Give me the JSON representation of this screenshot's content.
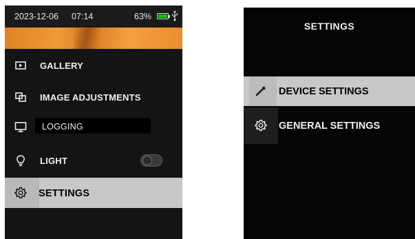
{
  "status_bar": {
    "date": "2023-12-06",
    "time": "07:14",
    "battery_percent": "63%",
    "battery_icon": "battery-icon",
    "usb_icon": "usb-icon"
  },
  "main_menu": {
    "items": [
      {
        "label": "GALLERY",
        "icon": "gallery-icon"
      },
      {
        "label": "IMAGE ADJUSTMENTS",
        "icon": "image-adjustments-icon"
      },
      {
        "label": "LOGGING",
        "icon": "monitor-icon"
      },
      {
        "label": "LIGHT",
        "icon": "lightbulb-icon",
        "toggle_on": false
      },
      {
        "label": "SETTINGS",
        "icon": "gear-icon",
        "selected": true
      }
    ]
  },
  "settings_menu": {
    "title": "SETTINGS",
    "items": [
      {
        "label": "DEVICE SETTINGS",
        "icon": "wrench-icon",
        "selected": true
      },
      {
        "label": "GENERAL SETTINGS",
        "icon": "gear-icon"
      }
    ]
  },
  "colors": {
    "selected_background": "#c8c8c8",
    "screen_background": "#141414",
    "battery_fill": "#18c21a",
    "thermal_orange": "#e8892c"
  }
}
